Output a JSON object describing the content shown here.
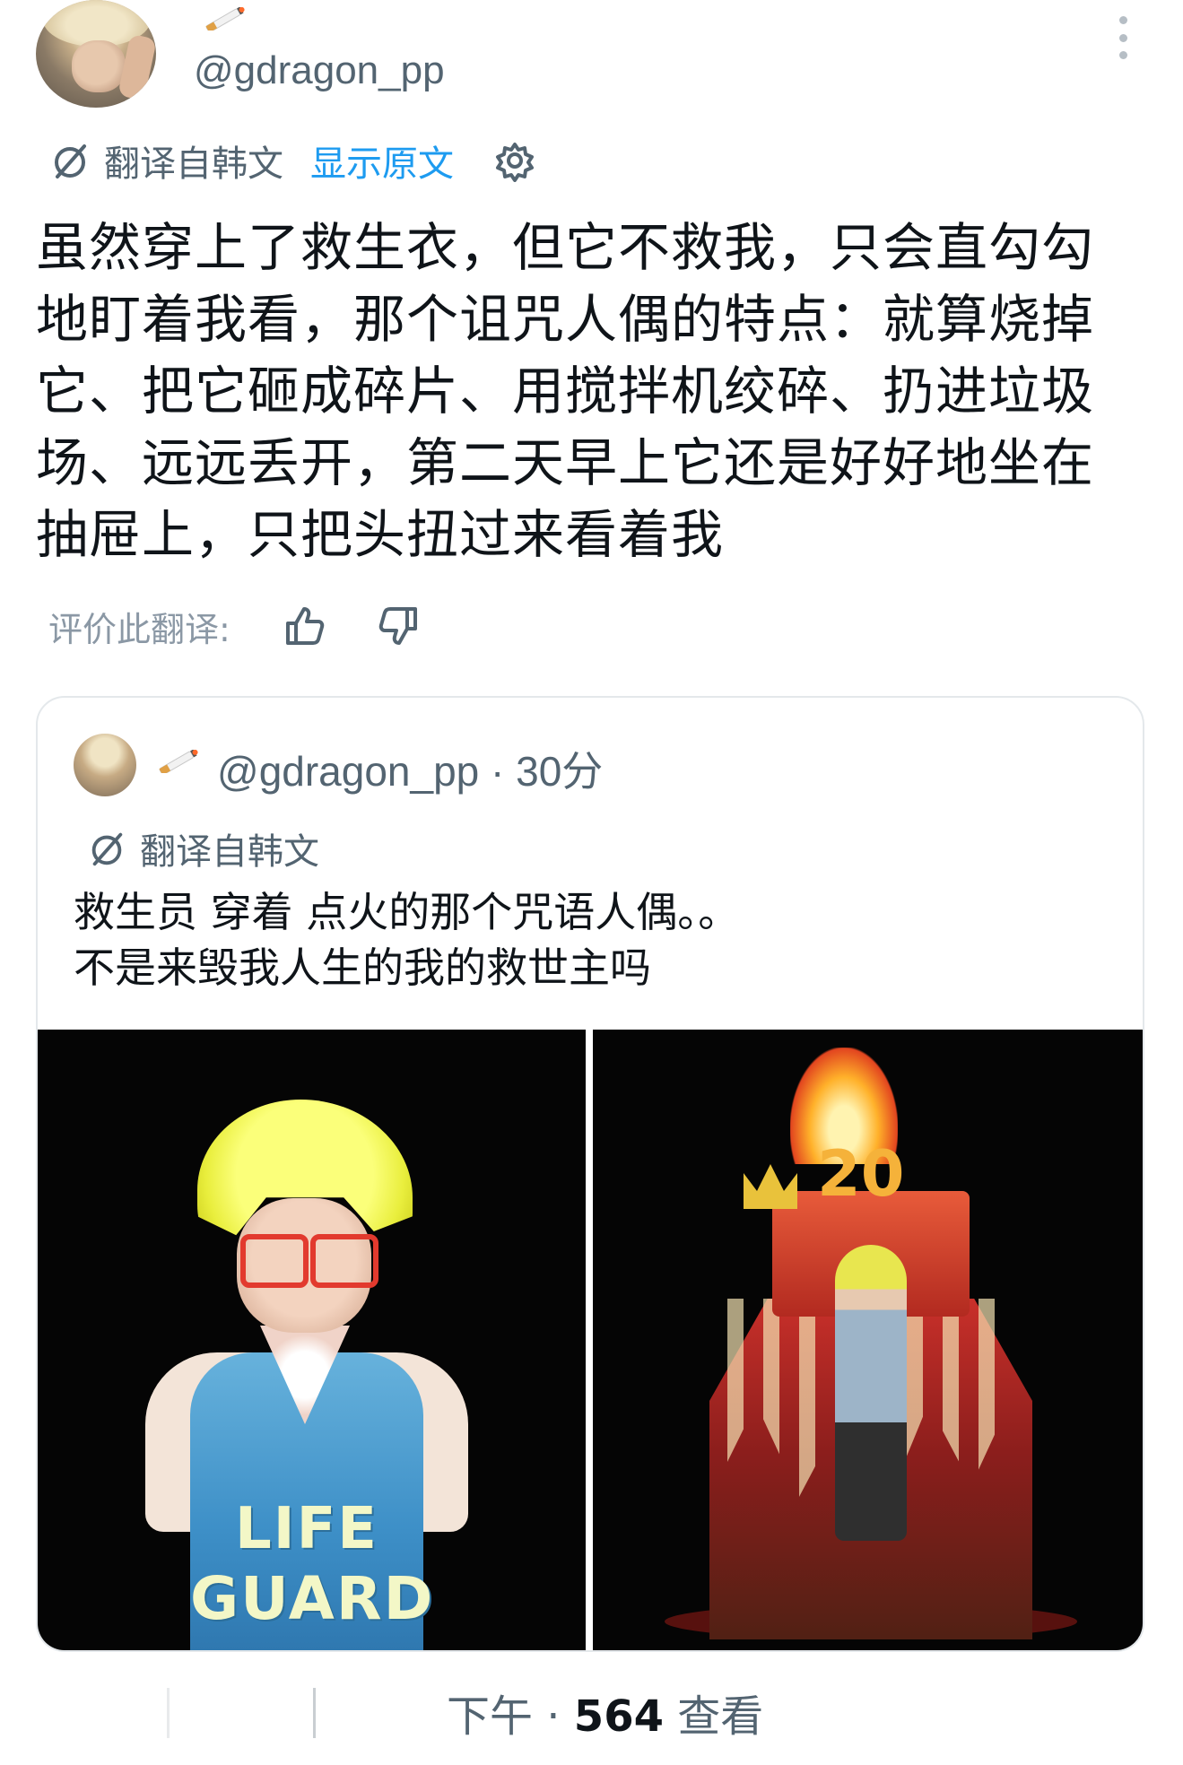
{
  "header": {
    "handle": "@gdragon_pp",
    "badge_icon": "cigarette-emoji-icon"
  },
  "translation": {
    "label": "翻译自韩文",
    "show_original": "显示原文",
    "icon": "translate-icon",
    "settings_icon": "gear-icon"
  },
  "tweet": {
    "text_lines": [
      "虽然穿上了救生衣，但它不救我，只会直勾勾",
      "地盯着我看，那个诅咒人偶的特点：就算烧掉",
      "它、把它砸成碎片、用搅拌机绞碎、扔进垃圾",
      "场、远远丢开，第二天早上它还是好好地坐在",
      "抽屉上，只把头扭过来看着我"
    ]
  },
  "rating": {
    "label": "评价此翻译:",
    "like_icon": "thumbs-up-icon",
    "dislike_icon": "thumbs-down-icon"
  },
  "quote": {
    "handle": "@gdragon_pp",
    "time": "· 30分",
    "translation_label": "翻译自韩文",
    "text_lines": [
      "救生员 穿着 点火的那个咒语人偶。。",
      "不是来毁我人生的我的救世主吗"
    ],
    "images": [
      {
        "shirt_text_1": "LIFE",
        "shirt_text_2": "GUARD"
      },
      {
        "cake_number": "20"
      }
    ]
  },
  "footer": {
    "time": "下午 ·",
    "views_count": "564",
    "views_label": "查看"
  },
  "colors": {
    "link": "#1d9bf0",
    "secondary_text": "#536471",
    "primary_text": "#0f1419",
    "border": "#e4e8eb"
  }
}
